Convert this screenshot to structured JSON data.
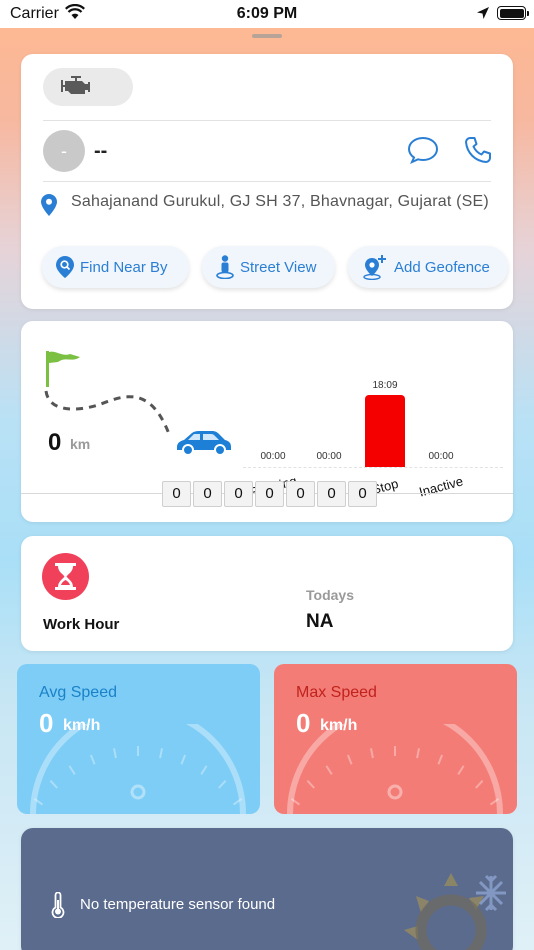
{
  "status_bar": {
    "carrier": "Carrier",
    "time": "6:09 PM"
  },
  "vehicle": {
    "driver_name": "--",
    "avatar_initial": "-",
    "address": "Sahajanand Gurukul, GJ SH 37, Bhavnagar, Gujarat (SE)",
    "actions": {
      "find_near_by": "Find Near By",
      "street_view": "Street View",
      "add_geofence": "Add Geofence"
    }
  },
  "trip": {
    "distance_value": "0",
    "distance_unit": "km",
    "odometer": [
      "0",
      "0",
      "0",
      "0",
      "0",
      "0",
      "0"
    ]
  },
  "chart_data": {
    "type": "bar",
    "categories": [
      "Running",
      "Idle",
      "Stop",
      "Inactive"
    ],
    "value_labels": [
      "00:00",
      "00:00",
      "18:09",
      "00:00"
    ],
    "values_minutes": [
      0,
      0,
      1089,
      0
    ],
    "bar_color": "#f40000"
  },
  "work_hour": {
    "label": "Work Hour",
    "todays_label": "Todays",
    "todays_value": "NA"
  },
  "speed": {
    "avg": {
      "title": "Avg Speed",
      "value": "0",
      "unit": "km/h"
    },
    "max": {
      "title": "Max Speed",
      "value": "0",
      "unit": "km/h"
    }
  },
  "temperature": {
    "message": "No temperature sensor found"
  },
  "colors": {
    "accent": "#2a7fd4",
    "avg_speed_bg": "#7ecdf6",
    "max_speed_bg": "#f47c76",
    "temp_card_bg": "#5b6b8d",
    "work_icon": "#f0405a"
  }
}
